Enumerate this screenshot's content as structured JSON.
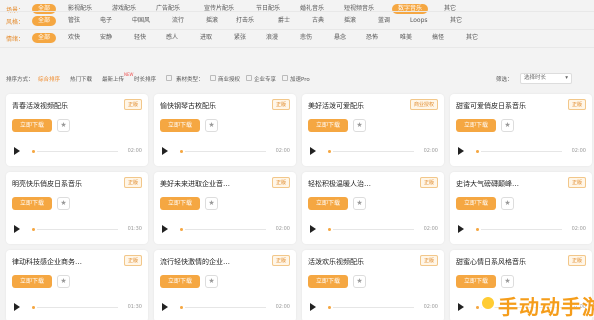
{
  "filters": {
    "scene": {
      "label": "场景：",
      "options": [
        "全部",
        "影视配乐",
        "游戏配乐",
        "广告配乐",
        "宣传片配乐",
        "节日配乐",
        "婚礼音乐",
        "短视频音乐",
        "数字音乐",
        "其它"
      ],
      "active_index": 8
    },
    "style": {
      "label": "风格：",
      "options": [
        "全部",
        "管弦",
        "电子",
        "中国风",
        "流行",
        "摇滚",
        "打击乐",
        "爵士",
        "古典",
        "摇滚",
        "蓝调",
        "Loops",
        "其它"
      ],
      "active_index": 0
    },
    "mood": {
      "label": "情绪：",
      "options": [
        "全部",
        "欢快",
        "安静",
        "轻快",
        "感人",
        "进取",
        "紧张",
        "浪漫",
        "悲伤",
        "悬念",
        "恐怖",
        "唯美",
        "搞怪",
        "其它"
      ],
      "active_index": 0
    }
  },
  "sort": {
    "label": "排序方式：",
    "options": [
      "综合排序",
      "热门下载",
      "最新上传",
      "时长排序"
    ],
    "active_index": 0,
    "new_badge": "NEW",
    "type_label": "素材类型：",
    "checkboxes": [
      "商业授权",
      "企业专享",
      "加速Pro"
    ],
    "filter_label": "筛选：",
    "select_placeholder": "选择时长"
  },
  "cards": [
    {
      "title": "青春活泼视频配乐",
      "tag": "正版",
      "download": "立即下载",
      "duration": "02:00"
    },
    {
      "title": "愉快钢琴古枚配乐",
      "tag": "正版",
      "download": "立即下载",
      "duration": "02:00"
    },
    {
      "title": "美好活泼可爱配乐",
      "tag": "商业授权",
      "download": "立即下载",
      "duration": "02:00"
    },
    {
      "title": "甜蜜可爱俏皮日系音乐",
      "tag": "正版",
      "download": "立即下载",
      "duration": "02:00"
    },
    {
      "title": "明亮快乐俏皮日系音乐",
      "tag": "正版",
      "download": "立即下载",
      "duration": "01:30"
    },
    {
      "title": "美好未来进取企业音…",
      "tag": "正版",
      "download": "立即下载",
      "duration": "02:00"
    },
    {
      "title": "轻松积极温暖人治…",
      "tag": "正版",
      "download": "立即下载",
      "duration": "02:00"
    },
    {
      "title": "史诗大气磅礴颠峰…",
      "tag": "正版",
      "download": "立即下载",
      "duration": "02:00"
    },
    {
      "title": "律动科技感企业商务…",
      "tag": "正版",
      "download": "立即下载",
      "duration": "01:30"
    },
    {
      "title": "流行轻快激情的企业…",
      "tag": "正版",
      "download": "立即下载",
      "duration": "02:00"
    },
    {
      "title": "活泼欢乐视频配乐",
      "tag": "正版",
      "download": "立即下载",
      "duration": "02:00"
    },
    {
      "title": "甜蜜心情日系风格音乐",
      "tag": "正版",
      "download": "立即下载",
      "duration": "02:00"
    }
  ],
  "watermark": "手动动手游",
  "accent_color": "#f5a742"
}
